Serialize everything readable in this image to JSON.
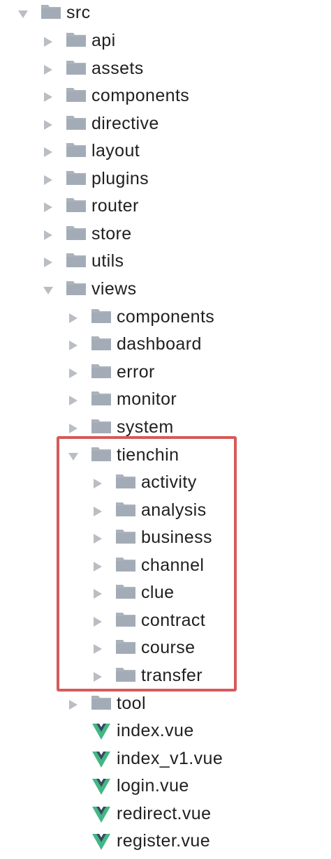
{
  "tree": {
    "root": {
      "label": "src",
      "expanded": true
    },
    "src_children": [
      {
        "label": "api",
        "expanded": false
      },
      {
        "label": "assets",
        "expanded": false
      },
      {
        "label": "components",
        "expanded": false
      },
      {
        "label": "directive",
        "expanded": false
      },
      {
        "label": "layout",
        "expanded": false
      },
      {
        "label": "plugins",
        "expanded": false
      },
      {
        "label": "router",
        "expanded": false
      },
      {
        "label": "store",
        "expanded": false
      },
      {
        "label": "utils",
        "expanded": false
      }
    ],
    "views": {
      "label": "views",
      "expanded": true
    },
    "views_children": [
      {
        "label": "components",
        "expanded": false
      },
      {
        "label": "dashboard",
        "expanded": false
      },
      {
        "label": "error",
        "expanded": false
      },
      {
        "label": "monitor",
        "expanded": false
      },
      {
        "label": "system",
        "expanded": false
      }
    ],
    "tienchin": {
      "label": "tienchin",
      "expanded": true
    },
    "tienchin_children": [
      {
        "label": "activity",
        "expanded": false
      },
      {
        "label": "analysis",
        "expanded": false
      },
      {
        "label": "business",
        "expanded": false
      },
      {
        "label": "channel",
        "expanded": false
      },
      {
        "label": "clue",
        "expanded": false
      },
      {
        "label": "contract",
        "expanded": false
      },
      {
        "label": "course",
        "expanded": false
      },
      {
        "label": "transfer",
        "expanded": false
      }
    ],
    "tool": {
      "label": "tool",
      "expanded": false
    },
    "vue_files": [
      {
        "label": "index.vue"
      },
      {
        "label": "index_v1.vue"
      },
      {
        "label": "login.vue"
      },
      {
        "label": "redirect.vue"
      },
      {
        "label": "register.vue"
      }
    ]
  },
  "colors": {
    "folder": "#aab3bc",
    "folder_dark": "#9aa3ad",
    "arrow": "#b9bec4",
    "text": "#1f1f1f",
    "highlight_border": "#d65a59",
    "vue_green": "#41b883",
    "vue_dark": "#35495e"
  },
  "icons": {
    "folder": "folder-icon",
    "arrow_collapsed": "chevron-right-icon",
    "arrow_expanded": "chevron-down-icon",
    "vue_file": "vue-file-icon"
  }
}
